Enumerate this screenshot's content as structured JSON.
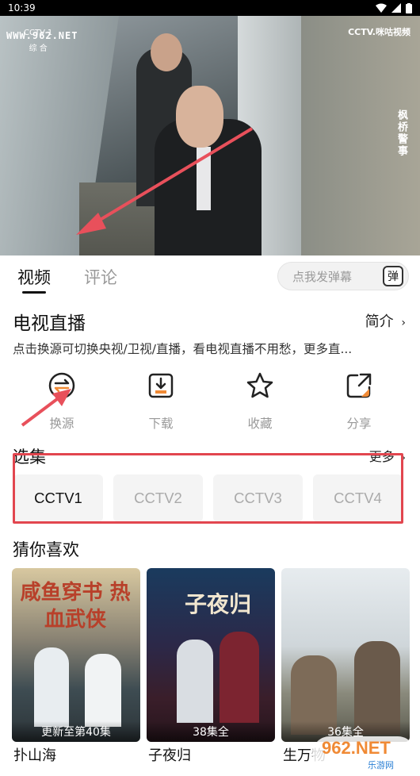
{
  "status_bar": {
    "time": "10:39"
  },
  "video": {
    "watermark_url": "WWW.962.NET",
    "channel_logo": "CCTV-1",
    "channel_sub": "综 合",
    "brand": "CCTV.咪咕视频",
    "show_title": "枫桥警事"
  },
  "tabs": [
    {
      "label": "视频",
      "active": true
    },
    {
      "label": "评论",
      "active": false
    }
  ],
  "danmaku": {
    "placeholder": "点我发弹幕",
    "icon_label": "弹"
  },
  "program": {
    "title": "电视直播",
    "intro_label": "简介",
    "description": "点击换源可切换央视/卫视/直播，看电视直播不用愁，更多直..."
  },
  "actions": [
    {
      "label": "换源",
      "icon": "switch-source-icon"
    },
    {
      "label": "下载",
      "icon": "download-icon"
    },
    {
      "label": "收藏",
      "icon": "star-icon"
    },
    {
      "label": "分享",
      "icon": "share-icon"
    }
  ],
  "episodes": {
    "title": "选集",
    "more_label": "更多",
    "items": [
      "CCTV1",
      "CCTV2",
      "CCTV3",
      "CCTV4"
    ],
    "selected": "CCTV1"
  },
  "recommend": {
    "title": "猜你喜欢",
    "items": [
      {
        "title": "扑山海",
        "badge": "更新至第40集",
        "poster_text": "咸鱼穿书 热血武侠"
      },
      {
        "title": "子夜归",
        "badge": "38集全",
        "poster_text": "子夜归"
      },
      {
        "title": "生万物",
        "badge": "36集全",
        "poster_text": ""
      }
    ]
  },
  "footer_logo": {
    "main": "962.NET",
    "sub": "乐游网"
  },
  "colors": {
    "accent": "#f08a35",
    "annotation": "#e2464f"
  }
}
